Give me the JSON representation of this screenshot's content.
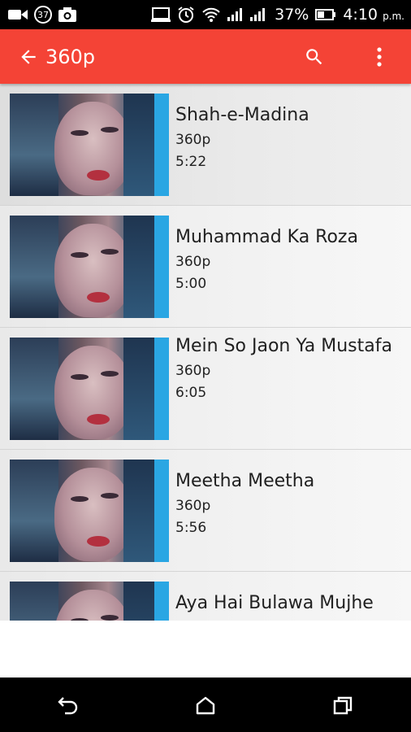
{
  "status_bar": {
    "notification_badge": "37",
    "battery_percent": "37%",
    "time": "4:10",
    "time_suffix": "p.m."
  },
  "app_bar": {
    "title": "360p",
    "background_color": "#f44336"
  },
  "videos": [
    {
      "title": "Shah-e-Madina",
      "quality": "360p",
      "duration": "5:22"
    },
    {
      "title": "Muhammad Ka Roza",
      "quality": "360p",
      "duration": "5:00"
    },
    {
      "title": "Mein So Jaon Ya Mustafa",
      "quality": "360p",
      "duration": "6:05"
    },
    {
      "title": "Meetha Meetha",
      "quality": "360p",
      "duration": "5:56"
    },
    {
      "title": "Aya Hai Bulawa Mujhe",
      "quality": "",
      "duration": ""
    }
  ],
  "nav_bar": {
    "back": "back-icon",
    "home": "home-icon",
    "recents": "recents-icon"
  }
}
